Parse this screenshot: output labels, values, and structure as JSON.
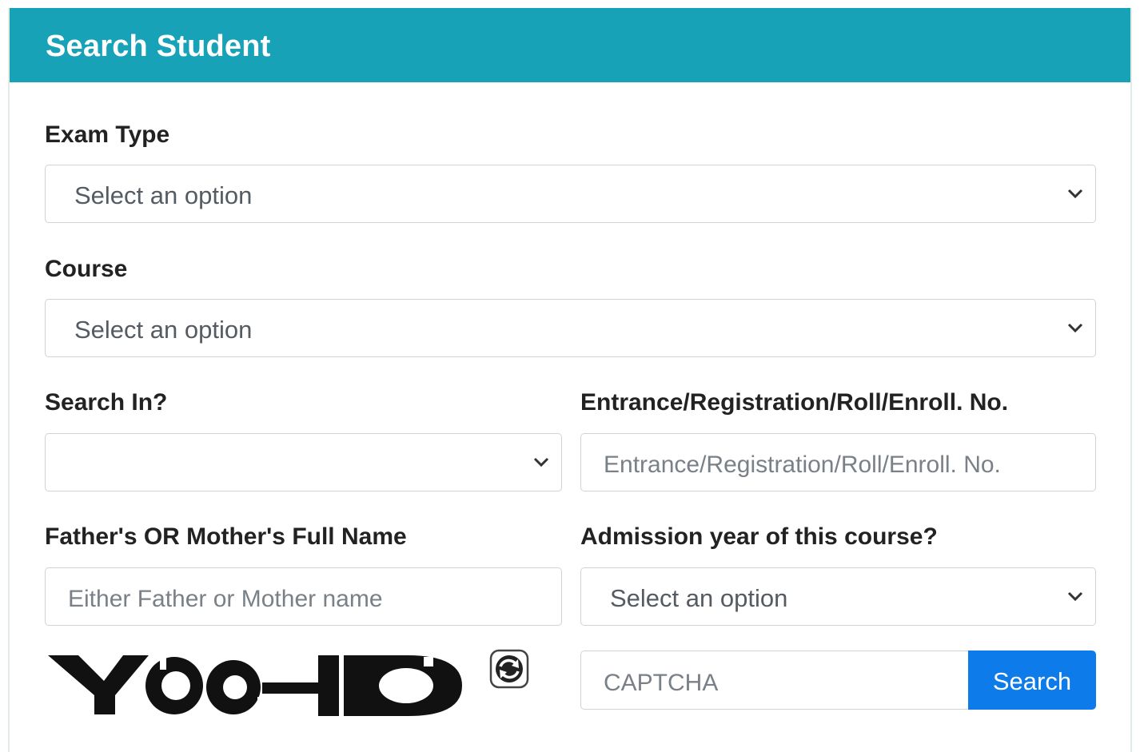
{
  "header": {
    "title": "Search Student"
  },
  "exam_type": {
    "label": "Exam Type",
    "value": "Select an option"
  },
  "course": {
    "label": "Course",
    "value": "Select an option"
  },
  "search_in": {
    "label": "Search In?",
    "value": ""
  },
  "reg_no": {
    "label": "Entrance/Registration/Roll/Enroll. No.",
    "placeholder": "Entrance/Registration/Roll/Enroll. No."
  },
  "parent_name": {
    "label": "Father's OR Mother's Full Name",
    "placeholder": "Either Father or Mother name"
  },
  "admission_year": {
    "label": "Admission year of this course?",
    "value": "Select an option"
  },
  "captcha": {
    "image_text": "YCHD",
    "placeholder": "CAPTCHA"
  },
  "search_button": {
    "label": "Search"
  },
  "colors": {
    "header_bg": "#17a2b8",
    "button_bg": "#0d7bea"
  }
}
